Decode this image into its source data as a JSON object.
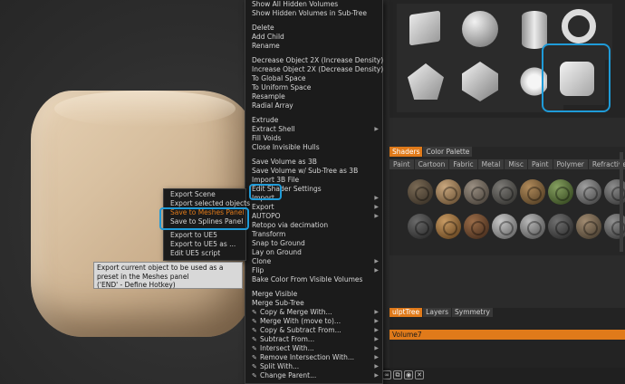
{
  "main_menu": {
    "items": [
      {
        "label": "Show All Hidden Volumes"
      },
      {
        "label": "Show Hidden Volumes in Sub-Tree"
      },
      {
        "sep": true
      },
      {
        "label": "Delete"
      },
      {
        "label": "Add Child"
      },
      {
        "label": "Rename"
      },
      {
        "sep": true
      },
      {
        "label": "Decrease Object 2X (Increase Density)"
      },
      {
        "label": "Increase Object 2X (Decrease Density)"
      },
      {
        "label": "To Global Space"
      },
      {
        "label": "To Uniform Space"
      },
      {
        "label": "Resample"
      },
      {
        "label": "Radial Array"
      },
      {
        "sep": true
      },
      {
        "label": "Extrude"
      },
      {
        "label": "Extract Shell",
        "arrow": true
      },
      {
        "label": "Fill Voids"
      },
      {
        "label": "Close Invisible Hulls"
      },
      {
        "sep": true
      },
      {
        "label": "Save Volume as 3B"
      },
      {
        "label": "Save Volume w/ Sub-Tree as 3B"
      },
      {
        "label": "Import 3B File"
      },
      {
        "label": "Edit Shader Settings"
      },
      {
        "label": "Import",
        "arrow": true
      },
      {
        "label": "Export",
        "arrow": true,
        "highlight": true
      },
      {
        "label": "AUTOPO",
        "arrow": true
      },
      {
        "label": "Retopo via decimation"
      },
      {
        "label": "Transform"
      },
      {
        "label": "Snap to Ground"
      },
      {
        "label": "Lay on Ground"
      },
      {
        "label": "Clone",
        "arrow": true
      },
      {
        "label": "Flip",
        "arrow": true
      },
      {
        "label": "Bake Color From Visible Volumes"
      },
      {
        "sep": true
      },
      {
        "label": "Merge Visible"
      },
      {
        "label": "Merge Sub-Tree"
      },
      {
        "label": "Copy & Merge With...",
        "arrow": true,
        "brush": true
      },
      {
        "label": "Merge With (move to)...",
        "arrow": true,
        "brush": true
      },
      {
        "label": "Copy & Subtract From...",
        "arrow": true,
        "brush": true
      },
      {
        "label": "Subtract From...",
        "arrow": true,
        "brush": true
      },
      {
        "label": "Intersect With...",
        "arrow": true,
        "brush": true
      },
      {
        "label": "Remove Intersection With...",
        "arrow": true,
        "brush": true
      },
      {
        "label": "Split With...",
        "arrow": true,
        "brush": true
      },
      {
        "label": "Change Parent...",
        "arrow": true,
        "brush": true
      }
    ]
  },
  "export_submenu": {
    "items": [
      {
        "label": "Export Scene"
      },
      {
        "label": "Export selected objects"
      },
      {
        "label": "Save to Meshes Panel",
        "orange": true
      },
      {
        "label": "Save to Splines Panel"
      },
      {
        "sep": true
      },
      {
        "label": "Export to UE5"
      },
      {
        "label": "Export to UE5 as ..."
      },
      {
        "label": "Edit UE5 script"
      }
    ]
  },
  "tooltip": {
    "line1": "Export current object to be used as a",
    "line2": "preset in the Meshes panel",
    "line3": "('END' - Define Hotkey)"
  },
  "meshes_panel": {
    "thumbs": [
      "cube-thumb",
      "sphere-thumb",
      "cylinder-thumb",
      "torus-thumb",
      "dodecahedron-thumb",
      "icosahedron-thumb",
      "spiky-ball-thumb",
      "saved-cube-thumb"
    ]
  },
  "shader_tabs": [
    "Shaders",
    "Color Palette"
  ],
  "shader_categories": [
    "Paint",
    "Cartoon",
    "Fabric",
    "Metal",
    "Misc",
    "Paint",
    "Polymer",
    "Refractive"
  ],
  "shader_balls": [
    {
      "c1": "#7a6a55",
      "c2": "#3e352a"
    },
    {
      "c1": "#c9a77e",
      "c2": "#6e5538"
    },
    {
      "c1": "#9a8f82",
      "c2": "#4e473f"
    },
    {
      "c1": "#7c7a76",
      "c2": "#3a3936"
    },
    {
      "c1": "#b08a5a",
      "c2": "#5a4428"
    },
    {
      "c1": "#86a060",
      "c2": "#3a4d24"
    },
    {
      "c1": "#a0a0a0",
      "c2": "#4a4a4a"
    },
    {
      "c1": "#8c8c8c",
      "c2": "#3e3e3e"
    },
    {
      "c1": "#6a6a6a",
      "c2": "#2e2e2e"
    },
    {
      "c1": "#c79a63",
      "c2": "#6c4a24"
    },
    {
      "c1": "#9a6c48",
      "c2": "#4d3220"
    },
    {
      "c1": "#c7c7c7",
      "c2": "#6a6a6a"
    },
    {
      "c1": "#b8b8b8",
      "c2": "#5a5a5a"
    },
    {
      "c1": "#707070",
      "c2": "#303030"
    },
    {
      "c1": "#a08a70",
      "c2": "#4e4334"
    },
    {
      "c1": "#909090",
      "c2": "#404040"
    }
  ],
  "tree_tabs": [
    "ulptTree",
    "Layers",
    "Symmetry"
  ],
  "volume_label": "Volume7",
  "colors": {
    "accent": "#e07a1a",
    "highlight_box": "#1f9bd8"
  }
}
